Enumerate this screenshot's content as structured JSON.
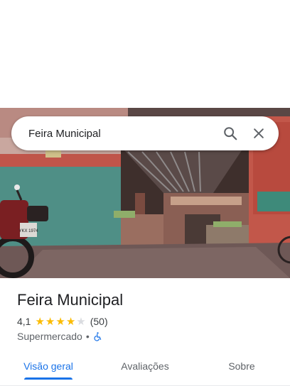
{
  "search": {
    "query": "Feira Municipal",
    "search_icon": "search-icon",
    "clear_icon": "close-icon"
  },
  "photo": {
    "sign_left": "",
    "plate": "YKX 1974"
  },
  "place": {
    "name": "Feira Municipal",
    "rating": "4,1",
    "stars": 4,
    "reviews": "(50)",
    "category": "Supermercado",
    "separator": "•",
    "accessibility_icon": "wheelchair-icon"
  },
  "tabs": [
    {
      "label": "Visão geral",
      "active": true
    },
    {
      "label": "Avaliações",
      "active": false
    },
    {
      "label": "Sobre",
      "active": false
    }
  ],
  "colors": {
    "accent": "#1a73e8",
    "star": "#fbbc04",
    "text": "#202124",
    "secondary": "#5f6368"
  }
}
